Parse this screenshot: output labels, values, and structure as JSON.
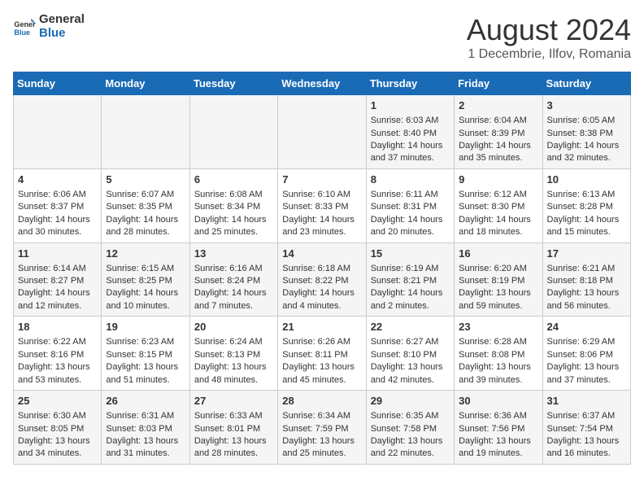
{
  "logo": {
    "line1": "General",
    "line2": "Blue"
  },
  "title": "August 2024",
  "subtitle": "1 Decembrie, Ilfov, Romania",
  "days_of_week": [
    "Sunday",
    "Monday",
    "Tuesday",
    "Wednesday",
    "Thursday",
    "Friday",
    "Saturday"
  ],
  "weeks": [
    [
      {
        "day": "",
        "content": ""
      },
      {
        "day": "",
        "content": ""
      },
      {
        "day": "",
        "content": ""
      },
      {
        "day": "",
        "content": ""
      },
      {
        "day": "1",
        "content": "Sunrise: 6:03 AM\nSunset: 8:40 PM\nDaylight: 14 hours and 37 minutes."
      },
      {
        "day": "2",
        "content": "Sunrise: 6:04 AM\nSunset: 8:39 PM\nDaylight: 14 hours and 35 minutes."
      },
      {
        "day": "3",
        "content": "Sunrise: 6:05 AM\nSunset: 8:38 PM\nDaylight: 14 hours and 32 minutes."
      }
    ],
    [
      {
        "day": "4",
        "content": "Sunrise: 6:06 AM\nSunset: 8:37 PM\nDaylight: 14 hours and 30 minutes."
      },
      {
        "day": "5",
        "content": "Sunrise: 6:07 AM\nSunset: 8:35 PM\nDaylight: 14 hours and 28 minutes."
      },
      {
        "day": "6",
        "content": "Sunrise: 6:08 AM\nSunset: 8:34 PM\nDaylight: 14 hours and 25 minutes."
      },
      {
        "day": "7",
        "content": "Sunrise: 6:10 AM\nSunset: 8:33 PM\nDaylight: 14 hours and 23 minutes."
      },
      {
        "day": "8",
        "content": "Sunrise: 6:11 AM\nSunset: 8:31 PM\nDaylight: 14 hours and 20 minutes."
      },
      {
        "day": "9",
        "content": "Sunrise: 6:12 AM\nSunset: 8:30 PM\nDaylight: 14 hours and 18 minutes."
      },
      {
        "day": "10",
        "content": "Sunrise: 6:13 AM\nSunset: 8:28 PM\nDaylight: 14 hours and 15 minutes."
      }
    ],
    [
      {
        "day": "11",
        "content": "Sunrise: 6:14 AM\nSunset: 8:27 PM\nDaylight: 14 hours and 12 minutes."
      },
      {
        "day": "12",
        "content": "Sunrise: 6:15 AM\nSunset: 8:25 PM\nDaylight: 14 hours and 10 minutes."
      },
      {
        "day": "13",
        "content": "Sunrise: 6:16 AM\nSunset: 8:24 PM\nDaylight: 14 hours and 7 minutes."
      },
      {
        "day": "14",
        "content": "Sunrise: 6:18 AM\nSunset: 8:22 PM\nDaylight: 14 hours and 4 minutes."
      },
      {
        "day": "15",
        "content": "Sunrise: 6:19 AM\nSunset: 8:21 PM\nDaylight: 14 hours and 2 minutes."
      },
      {
        "day": "16",
        "content": "Sunrise: 6:20 AM\nSunset: 8:19 PM\nDaylight: 13 hours and 59 minutes."
      },
      {
        "day": "17",
        "content": "Sunrise: 6:21 AM\nSunset: 8:18 PM\nDaylight: 13 hours and 56 minutes."
      }
    ],
    [
      {
        "day": "18",
        "content": "Sunrise: 6:22 AM\nSunset: 8:16 PM\nDaylight: 13 hours and 53 minutes."
      },
      {
        "day": "19",
        "content": "Sunrise: 6:23 AM\nSunset: 8:15 PM\nDaylight: 13 hours and 51 minutes."
      },
      {
        "day": "20",
        "content": "Sunrise: 6:24 AM\nSunset: 8:13 PM\nDaylight: 13 hours and 48 minutes."
      },
      {
        "day": "21",
        "content": "Sunrise: 6:26 AM\nSunset: 8:11 PM\nDaylight: 13 hours and 45 minutes."
      },
      {
        "day": "22",
        "content": "Sunrise: 6:27 AM\nSunset: 8:10 PM\nDaylight: 13 hours and 42 minutes."
      },
      {
        "day": "23",
        "content": "Sunrise: 6:28 AM\nSunset: 8:08 PM\nDaylight: 13 hours and 39 minutes."
      },
      {
        "day": "24",
        "content": "Sunrise: 6:29 AM\nSunset: 8:06 PM\nDaylight: 13 hours and 37 minutes."
      }
    ],
    [
      {
        "day": "25",
        "content": "Sunrise: 6:30 AM\nSunset: 8:05 PM\nDaylight: 13 hours and 34 minutes."
      },
      {
        "day": "26",
        "content": "Sunrise: 6:31 AM\nSunset: 8:03 PM\nDaylight: 13 hours and 31 minutes."
      },
      {
        "day": "27",
        "content": "Sunrise: 6:33 AM\nSunset: 8:01 PM\nDaylight: 13 hours and 28 minutes."
      },
      {
        "day": "28",
        "content": "Sunrise: 6:34 AM\nSunset: 7:59 PM\nDaylight: 13 hours and 25 minutes."
      },
      {
        "day": "29",
        "content": "Sunrise: 6:35 AM\nSunset: 7:58 PM\nDaylight: 13 hours and 22 minutes."
      },
      {
        "day": "30",
        "content": "Sunrise: 6:36 AM\nSunset: 7:56 PM\nDaylight: 13 hours and 19 minutes."
      },
      {
        "day": "31",
        "content": "Sunrise: 6:37 AM\nSunset: 7:54 PM\nDaylight: 13 hours and 16 minutes."
      }
    ]
  ]
}
